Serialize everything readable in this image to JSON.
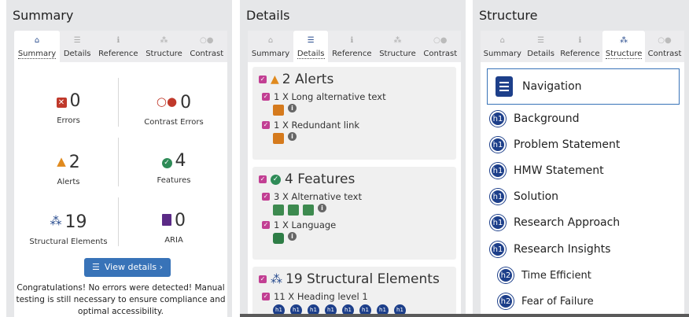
{
  "tabs": [
    {
      "label": "Summary",
      "icon": "home-icon",
      "glyph": "⌂"
    },
    {
      "label": "Details",
      "icon": "list-icon",
      "glyph": "☰"
    },
    {
      "label": "Reference",
      "icon": "info-icon",
      "glyph": "ℹ"
    },
    {
      "label": "Structure",
      "icon": "sitemap-icon",
      "glyph": "⁂"
    },
    {
      "label": "Contrast",
      "icon": "contrast-icon",
      "glyph": "○●"
    }
  ],
  "summary": {
    "title": "Summary",
    "errors": {
      "count": "0",
      "label": "Errors"
    },
    "contrast": {
      "count": "0",
      "label": "Contrast Errors"
    },
    "alerts": {
      "count": "2",
      "label": "Alerts"
    },
    "features": {
      "count": "4",
      "label": "Features"
    },
    "structural": {
      "count": "19",
      "label": "Structural Elements"
    },
    "aria": {
      "count": "0",
      "label": "ARIA"
    },
    "button": "View details ›",
    "message": "Congratulations! No errors were detected! Manual testing is still necessary to ensure compliance and optimal accessibility."
  },
  "details": {
    "title": "Details",
    "alerts_head": "2 Alerts",
    "alert_items": [
      "1 X Long alternative text",
      "1 X Redundant link"
    ],
    "features_head": "4 Features",
    "feature_items": [
      "3 X Alternative text",
      "1 X Language"
    ],
    "struct_head": "19 Structural Elements",
    "struct_items": [
      "11 X Heading level 1"
    ],
    "heading_badge": "h1"
  },
  "structure": {
    "title": "Structure",
    "nav_label": "Navigation",
    "headings": [
      {
        "level": "h1",
        "text": "Background"
      },
      {
        "level": "h1",
        "text": "Problem Statement"
      },
      {
        "level": "h1",
        "text": "HMW Statement"
      },
      {
        "level": "h1",
        "text": "Solution"
      },
      {
        "level": "h1",
        "text": "Research Approach"
      },
      {
        "level": "h1",
        "text": "Research Insights"
      },
      {
        "level": "h2",
        "text": "Time Efficient"
      },
      {
        "level": "h2",
        "text": "Fear of Failure"
      }
    ]
  },
  "colors": {
    "accent_blue": "#3873b8",
    "error_red": "#c0392b",
    "alert_orange": "#e08a1e",
    "feature_green": "#2e8b57",
    "navy": "#1d3f8a",
    "aria_purple": "#5b2a86",
    "checkbox_pink": "#c23f93"
  }
}
